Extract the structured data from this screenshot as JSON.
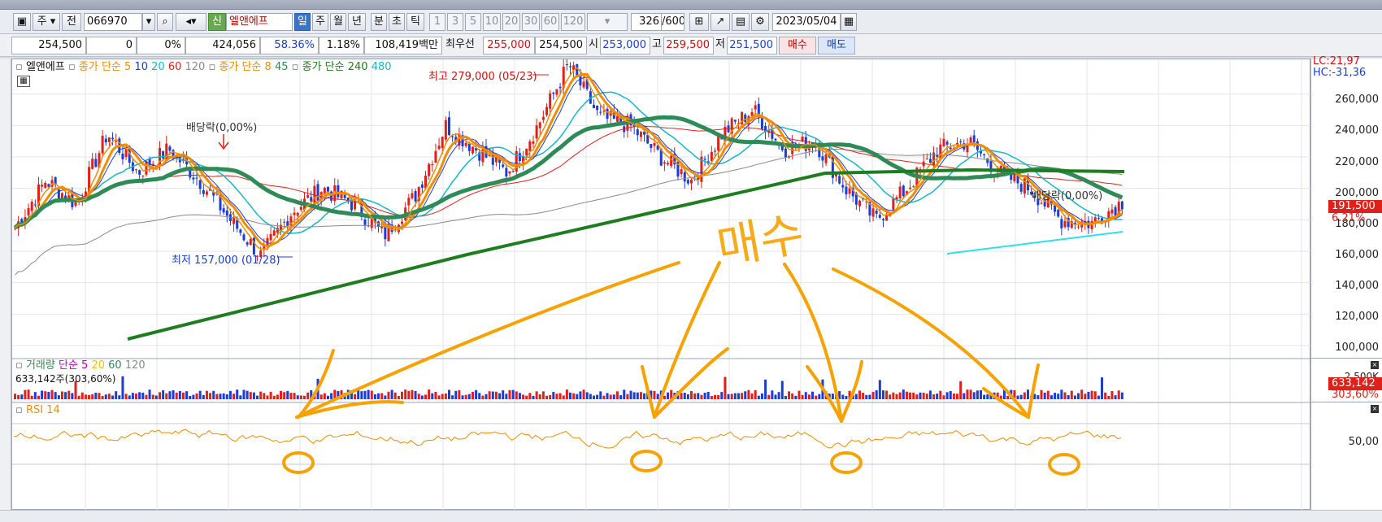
{
  "toolbar": {
    "period_day": "주",
    "prev_label": "전",
    "code": "066970",
    "new_badge": "신",
    "stock_name": "엘앤에프",
    "periods": [
      "일",
      "주",
      "월",
      "년",
      "분",
      "초",
      "틱"
    ],
    "active_period": "일",
    "intervals": [
      "1",
      "3",
      "5",
      "10",
      "20",
      "30",
      "60",
      "120"
    ],
    "count": "326",
    "total": "/600",
    "date": "2023/05/04"
  },
  "infobar": {
    "price": "254,500",
    "change": "0",
    "change_pct": "0%",
    "volume": "424,056",
    "turnover_pct": "58.36%",
    "vol_ratio": "1.18%",
    "amount": "108,419백만",
    "best_label": "최우선",
    "best_ask": "255,000",
    "best_bid": "254,500",
    "open_label": "시",
    "open": "253,000",
    "high_label": "고",
    "high": "259,500",
    "low_label": "저",
    "low": "251,500",
    "buy_button": "매수",
    "sell_button": "매도"
  },
  "legend": {
    "name": "엘앤에프",
    "ma_group1": "종가 단순",
    "ma_group1_periods": [
      "5",
      "10",
      "20",
      "60",
      "120"
    ],
    "ma_group2": "종가 단순",
    "ma_group2_periods": [
      "8",
      "45"
    ],
    "ma_group3": "종가 단순",
    "ma_group3_periods": [
      "240",
      "480"
    ],
    "lc": "LC:21,97",
    "hc": "HC:-31,36"
  },
  "annotations": {
    "high_note": "최고 279,000 (05/23)",
    "low_note": "최저 157,000 (01/28)",
    "dividend1": "배당락(0,00%)",
    "dividend2": "배당락(0,00%)",
    "handwriting": "매수"
  },
  "price_axis": {
    "ticks": [
      "260,000",
      "240,000",
      "220,000",
      "200,000",
      "180,000",
      "160,000",
      "140,000",
      "120,000",
      "100,000"
    ],
    "current": "191,500",
    "current_pct": "6.21%"
  },
  "volume_panel": {
    "title": "거래량",
    "ma_label": "단순",
    "ma_periods": [
      "5",
      "20",
      "60",
      "120"
    ],
    "value_text": "633,142주(303,60%)",
    "axis_tick": "2,500K",
    "flag_value": "633,142",
    "flag_pct": "303,60%"
  },
  "rsi_panel": {
    "title": "RSI 14",
    "axis_tick": "50,00"
  },
  "colors": {
    "up": "#e0201a",
    "down": "#1a3cd8",
    "ma5": "#f28c00",
    "ma10": "#1a3cd8",
    "ma20": "#16b8c8",
    "ma60": "#e0201a",
    "ma120": "#8a8a8a",
    "ma8": "#f28c00",
    "ma45": "#2e8b57",
    "ma240": "#1e7d1e",
    "ma480": "#16b8c8",
    "handwriting": "#f7a200",
    "trendline": "#2ce0f0"
  },
  "chart_data": {
    "type": "candlestick",
    "series": [
      {
        "name": "엘앤에프",
        "approx_close_path": [
          175000,
          205000,
          190000,
          235000,
          210000,
          225000,
          205000,
          180000,
          157000,
          185000,
          200000,
          190000,
          170000,
          195000,
          240000,
          225000,
          210000,
          240000,
          279000,
          245000,
          240000,
          220000,
          205000,
          235000,
          250000,
          225000,
          230000,
          200000,
          180000,
          200000,
          225000,
          230000,
          210000,
          200000,
          180000,
          178000,
          191500
        ]
      }
    ],
    "y_range": [
      100000,
      280000
    ],
    "highlights": {
      "high": 279000,
      "low": 157000
    }
  }
}
